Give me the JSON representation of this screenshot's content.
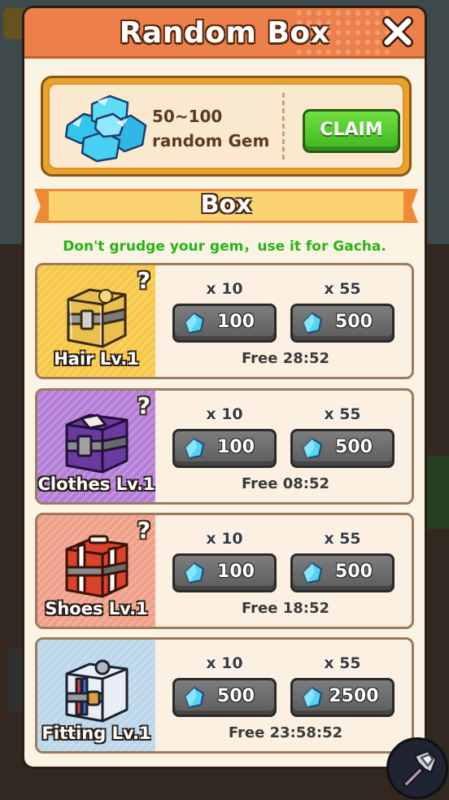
{
  "modal": {
    "title": "Random Box",
    "close_icon": "close-x-icon"
  },
  "gem_offer": {
    "amount": "50~100",
    "label": "random Gem",
    "claim_label": "CLAIM",
    "icon": "gem-pile-icon"
  },
  "section": {
    "title": "Box",
    "tagline": "Don't grudge your gem，use it for Gacha."
  },
  "boxes": [
    {
      "label": "Hair Lv.1",
      "badge": "?",
      "icon": "hair-chest-icon",
      "color": "#f7c847",
      "options": [
        {
          "qty": "x 10",
          "price": "100"
        },
        {
          "qty": "x 55",
          "price": "500"
        }
      ],
      "free_timer": "Free 28:52"
    },
    {
      "label": "Clothes Lv.1",
      "badge": "?",
      "icon": "clothes-chest-icon",
      "color": "#b57fd8",
      "options": [
        {
          "qty": "x 10",
          "price": "100"
        },
        {
          "qty": "x 55",
          "price": "500"
        }
      ],
      "free_timer": "Free 08:52"
    },
    {
      "label": "Shoes Lv.1",
      "badge": "?",
      "icon": "shoes-chest-icon",
      "color": "#f0a088",
      "options": [
        {
          "qty": "x 10",
          "price": "100"
        },
        {
          "qty": "x 55",
          "price": "500"
        }
      ],
      "free_timer": "Free 18:52"
    },
    {
      "label": "Fitting Lv.1",
      "badge": "?",
      "icon": "fitting-chest-icon",
      "color": "#bcd6ea",
      "options": [
        {
          "qty": "x 10",
          "price": "500"
        },
        {
          "qty": "x 55",
          "price": "2500"
        }
      ],
      "free_timer": "Free 23:58:52"
    }
  ],
  "floating_button": {
    "icon": "hammer-icon"
  }
}
